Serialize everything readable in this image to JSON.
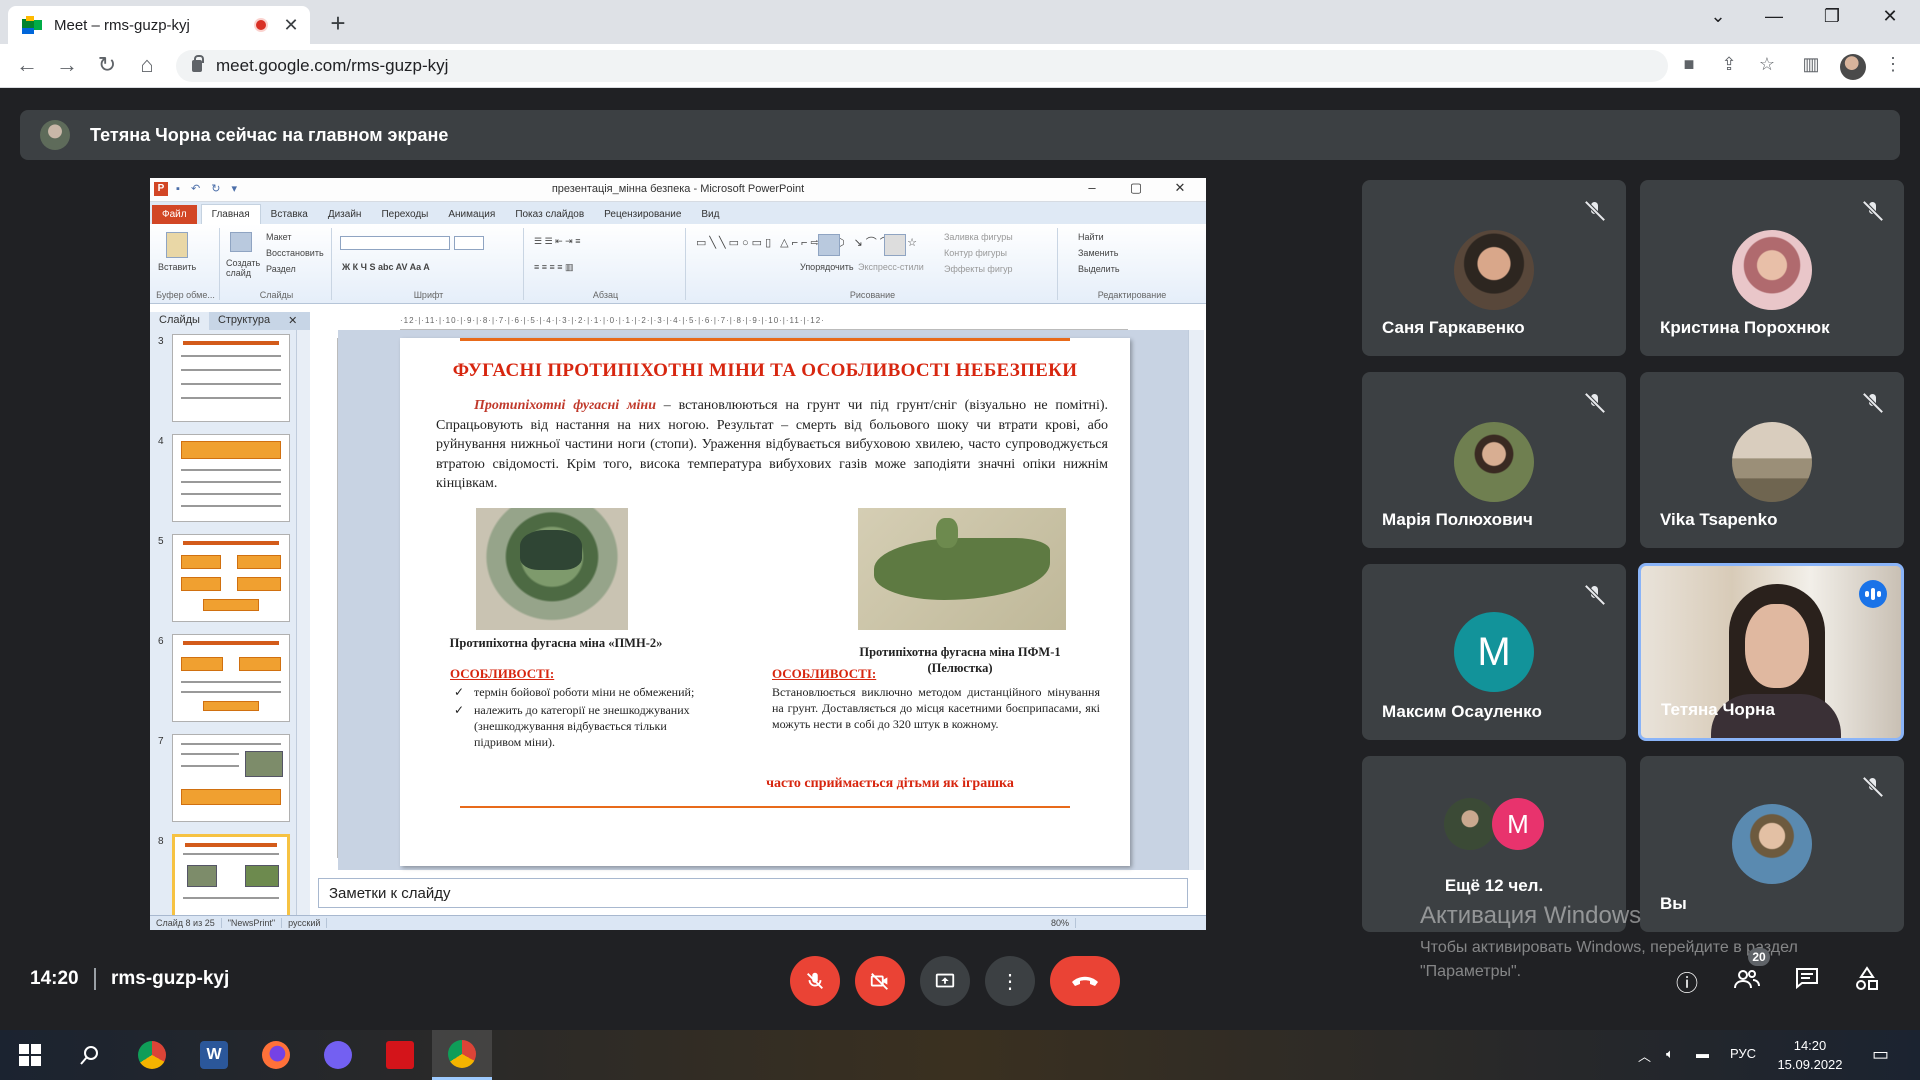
{
  "browser": {
    "tab_title": "Meet – rms-guzp-kyj",
    "url": "meet.google.com/rms-guzp-kyj",
    "tab_close": "✕",
    "new_tab": "+"
  },
  "banner": {
    "text": "Тетяна Чорна сейчас на главном экране"
  },
  "ppt": {
    "window_title": "презентація_мінна безпека - Microsoft PowerPoint",
    "tabs": [
      "Файл",
      "Главная",
      "Вставка",
      "Дизайн",
      "Переходы",
      "Анимация",
      "Показ слайдов",
      "Рецензирование",
      "Вид"
    ],
    "groups": {
      "clipboard": "Буфер обме...",
      "slides": "Слайды",
      "font": "Шрифт",
      "paragraph": "Абзац",
      "drawing": "Рисование",
      "editing": "Редактирование"
    },
    "ribbon_items": {
      "paste": "Вставить",
      "new_slide": "Создать слайд",
      "layout": "Макет",
      "reset": "Восстановить",
      "section": "Раздел",
      "arrange": "Упорядочить",
      "quick_styles": "Экспресс-стили",
      "fill": "Заливка фигуры",
      "outline": "Контур фигуры",
      "effects": "Эффекты фигур",
      "find": "Найти",
      "replace": "Заменить",
      "select": "Выделить"
    },
    "panel_tabs": [
      "Слайды",
      "Структура"
    ],
    "thumb_numbers": [
      "3",
      "4",
      "5",
      "6",
      "7",
      "8"
    ],
    "notes_placeholder": "Заметки к слайду",
    "status": {
      "slide": "Слайд 8 из 25",
      "theme": "\"NewsPrint\"",
      "lang": "русский",
      "zoom": "80%"
    },
    "slide": {
      "title": "ФУГАСНІ ПРОТИПІХОТНІ МІНИ ТА ОСОБЛИВОСТІ НЕБЕЗПЕКИ",
      "para_lead": "Протипіхотні фугасні міни",
      "para_rest": " – встановлюються на грунт чи під грунт/сніг (візуально не помітні). Спрацьовують від настання на них ногою. Результат – смерть від больового шоку чи втрати крові, або руйнування нижньої частини ноги (стопи). Ураження відбувається вибуховою хвилею, часто супроводжується втратою свідомості. Крім того, висока температура вибухових газів може заподіяти значні опіки нижнім кінцівкам.",
      "caption_left": "Протипіхотна фугасна міна «ПМН-2»",
      "caption_right": "Протипіхотна фугасна міна ПФМ-1 (Пелюстка)",
      "features_heading": "ОСОБЛИВОСТІ:",
      "features_left": [
        "термін бойової роботи міни не обмежений;",
        "належить до категорії не знешкоджуваних (знешкоджування відбувається тільки підривом міни)."
      ],
      "features_right": "Встановлюється виключно методом дистанційного мінування на грунт. Доставляється до місця касетними боєприпасами, які можуть нести в собі до 320 штук в кожному.",
      "warning": "часто сприймається дітьми як іграшка"
    }
  },
  "participants": [
    {
      "name": "Саня Гаркавенко"
    },
    {
      "name": "Кристина Порохнюк"
    },
    {
      "name": "Марія Полюхович"
    },
    {
      "name": "Vika Tsapenko"
    },
    {
      "name": "Максим Осауленко",
      "initial": "М"
    },
    {
      "name": "Тетяна Чорна"
    },
    {
      "name": "Ещё 12 чел.",
      "initial": "M"
    },
    {
      "name": "Вы"
    }
  ],
  "watermark": {
    "title": "Активация Windows",
    "text": "Чтобы активировать Windows, перейдите в раздел \"Параметры\"."
  },
  "bottom": {
    "time": "14:20",
    "meeting_code": "rms-guzp-kyj",
    "participants_count": "20"
  },
  "taskbar": {
    "lang": "РУС",
    "time": "14:20",
    "date": "15.09.2022"
  },
  "colors": {
    "meet_bg": "#202124",
    "tile_bg": "#3c4043",
    "danger": "#ea4335",
    "active_speaker": "#8ab4f8",
    "slide_title": "#d7260f"
  }
}
